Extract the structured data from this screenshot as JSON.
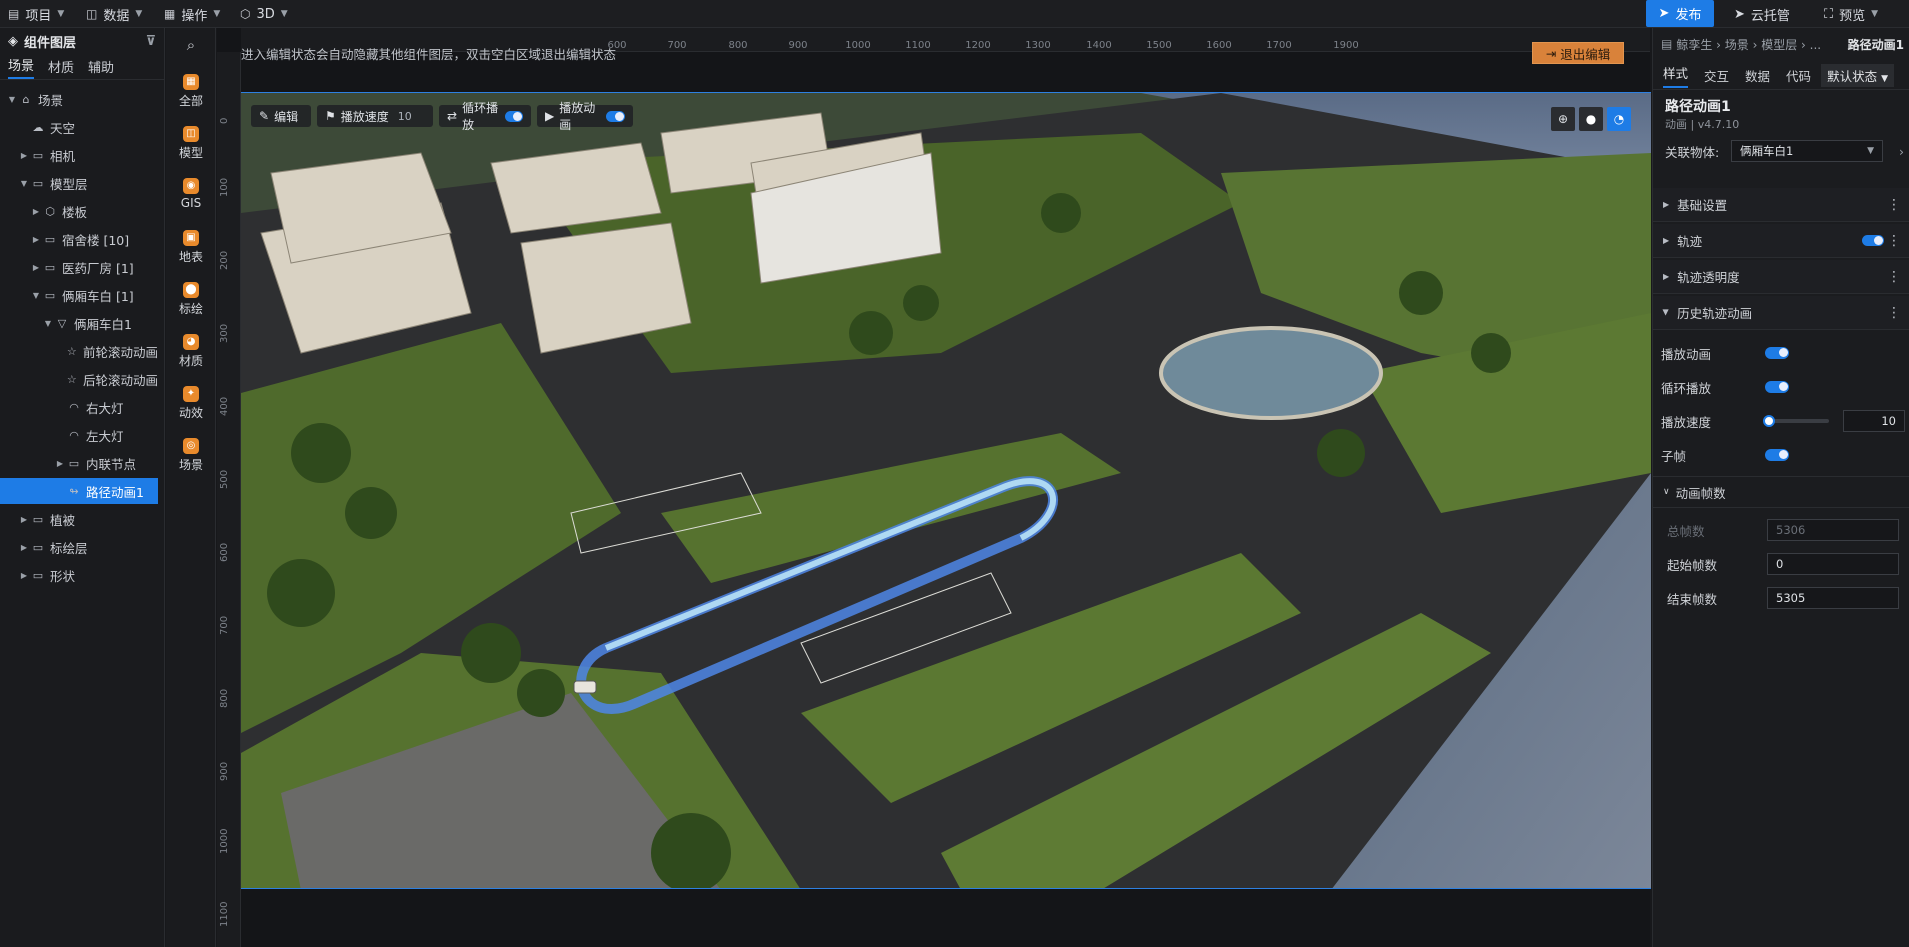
{
  "topbar": {
    "menus": [
      {
        "label": "项目"
      },
      {
        "label": "数据"
      },
      {
        "label": "操作"
      },
      {
        "label": "3D"
      }
    ],
    "publish_label": "发布",
    "cloud_label": "云托管",
    "preview_label": "预览"
  },
  "left_panel": {
    "title": "组件图层",
    "tabs": [
      "场景",
      "材质",
      "辅助"
    ],
    "tree": [
      {
        "label": "场景",
        "depth": 0,
        "expanded": true,
        "icon": "scene-icon"
      },
      {
        "label": "天空",
        "depth": 1,
        "icon": "sky-icon"
      },
      {
        "label": "相机",
        "depth": 1,
        "collapsed": true,
        "icon": "folder-icon"
      },
      {
        "label": "模型层",
        "depth": 1,
        "expanded": true,
        "icon": "folder-icon"
      },
      {
        "label": "楼板",
        "depth": 2,
        "collapsed": true,
        "icon": "cube-icon"
      },
      {
        "label": "宿舍楼 [10]",
        "depth": 2,
        "collapsed": true,
        "icon": "folder-icon"
      },
      {
        "label": "医药厂房 [1]",
        "depth": 2,
        "collapsed": true,
        "icon": "folder-icon"
      },
      {
        "label": "俩厢车白 [1]",
        "depth": 2,
        "expanded": true,
        "icon": "folder-icon"
      },
      {
        "label": "俩厢车白1",
        "depth": 3,
        "expanded": true,
        "icon": "mesh-icon"
      },
      {
        "label": "前轮滚动动画",
        "depth": 4,
        "icon": "star-icon"
      },
      {
        "label": "后轮滚动动画",
        "depth": 4,
        "icon": "star-icon"
      },
      {
        "label": "右大灯",
        "depth": 4,
        "icon": "light-icon"
      },
      {
        "label": "左大灯",
        "depth": 4,
        "icon": "light-icon"
      },
      {
        "label": "内联节点",
        "depth": 4,
        "collapsed": true,
        "icon": "folder-icon"
      },
      {
        "label": "路径动画1",
        "depth": 4,
        "selected": true,
        "icon": "path-icon"
      },
      {
        "label": "植被",
        "depth": 1,
        "collapsed": true,
        "icon": "folder-icon"
      },
      {
        "label": "标绘层",
        "depth": 1,
        "collapsed": true,
        "icon": "folder-icon"
      },
      {
        "label": "形状",
        "depth": 1,
        "collapsed": true,
        "icon": "folder-icon"
      }
    ]
  },
  "rail": {
    "items": [
      {
        "label": "全部",
        "color": "#e88a2c"
      },
      {
        "label": "模型",
        "color": "#e88a2c"
      },
      {
        "label": "GIS",
        "color": "#e88a2c"
      },
      {
        "label": "地表",
        "color": "#e88a2c"
      },
      {
        "label": "标绘",
        "color": "#e88a2c"
      },
      {
        "label": "材质",
        "color": "#e88a2c"
      },
      {
        "label": "动效",
        "color": "#e88a2c"
      },
      {
        "label": "场景",
        "color": "#e88a2c"
      }
    ]
  },
  "viewport": {
    "hint": "进入编辑状态会自动隐藏其他组件图层，双击空白区域退出编辑状态",
    "exit_label": "退出编辑",
    "ruler_top": [
      "600",
      "700",
      "800",
      "900",
      "1000",
      "1100",
      "1200",
      "1300",
      "1400",
      "1500",
      "1600",
      "1700",
      "1900"
    ],
    "ruler_left": [
      "0",
      "100",
      "200",
      "300",
      "400",
      "500",
      "600",
      "700",
      "800",
      "900",
      "1000",
      "1100"
    ],
    "controls": {
      "edit_label": "编辑",
      "speed_label": "播放速度",
      "speed_value": "10",
      "loop_label": "循环播放",
      "play_label": "播放动画"
    }
  },
  "right_panel": {
    "breadcrumb": "鲸孪生 › 场景 › 模型层 › ...",
    "current": "路径动画1",
    "tabs": [
      "样式",
      "交互",
      "数据",
      "代码"
    ],
    "state_select": "默认状态",
    "component_title": "路径动画1",
    "component_subtitle": "动画 | v4.7.10",
    "link_label": "关联物体:",
    "link_value": "俩厢车白1",
    "sections": [
      "基础设置",
      "轨迹",
      "轨迹透明度",
      "历史轨迹动画"
    ],
    "props": {
      "play_anim": "播放动画",
      "loop_play": "循环播放",
      "play_speed": "播放速度",
      "speed_value": "10",
      "subframe": "子帧",
      "frames_section": "动画帧数",
      "total_frames_label": "总帧数",
      "total_frames": "5306",
      "start_frame_label": "起始帧数",
      "start_frame": "0",
      "end_frame_label": "结束帧数",
      "end_frame": "5305"
    }
  },
  "colors": {
    "accent": "#1e7ce6",
    "orange": "#d9823a"
  }
}
